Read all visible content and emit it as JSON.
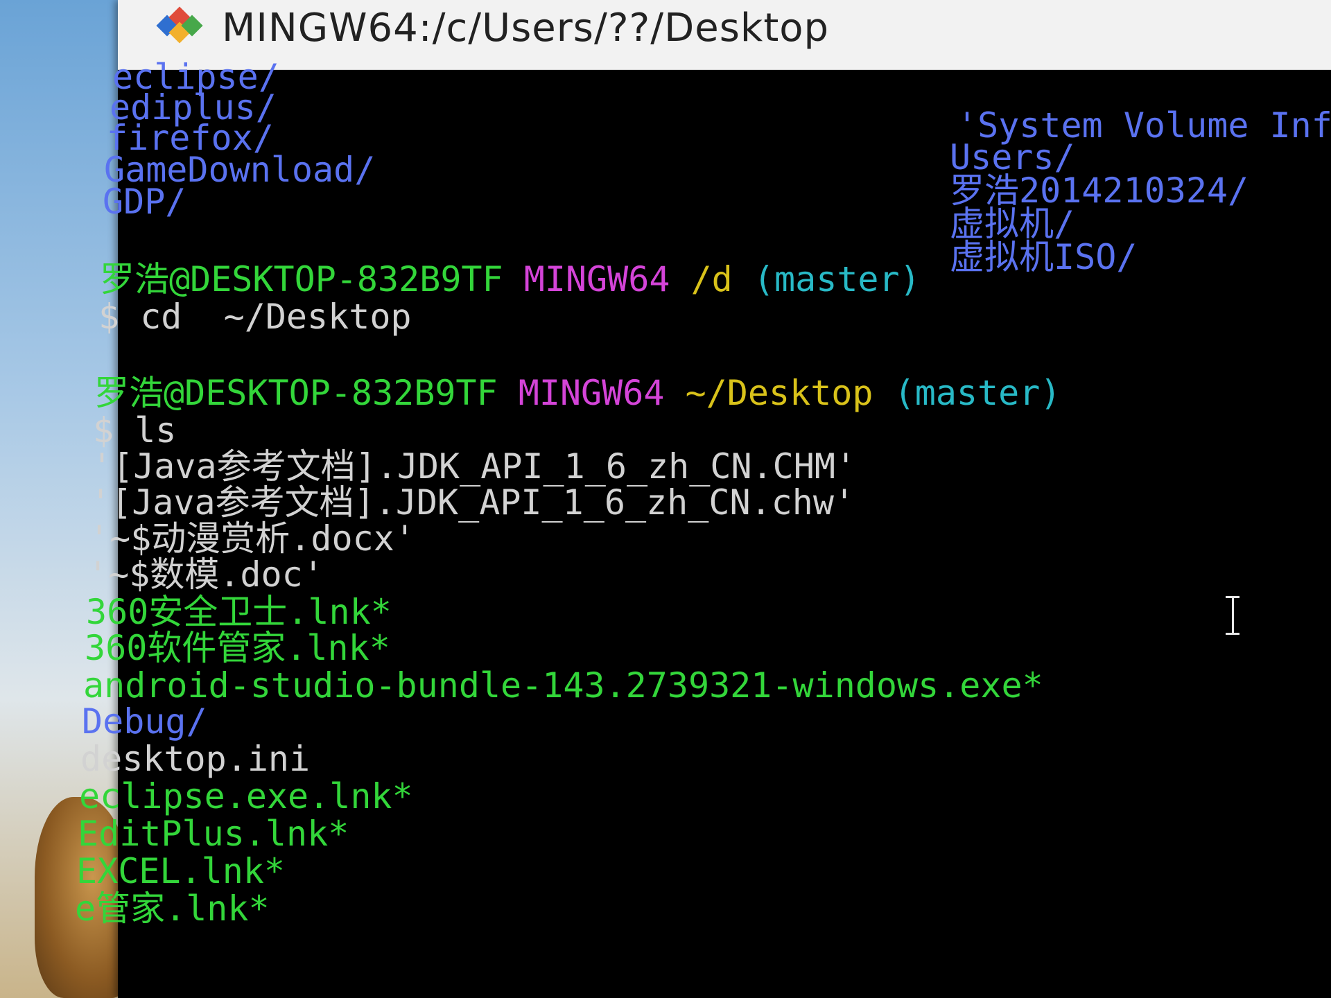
{
  "window": {
    "title": "MINGW64:/c/Users/??/Desktop"
  },
  "colors": {
    "directory": "#5a72f0",
    "executable": "#33d63a",
    "host": "#d444d8",
    "path": "#d9c21a",
    "branch": "#28b9c6",
    "plain": "#d2d2d2"
  },
  "terminal": {
    "prev_listing_left": [
      "eclipse/",
      "ediplus/",
      "firefox/",
      "GameDownload/",
      "GDP/"
    ],
    "prev_listing_right": [
      "'System Volume Inf",
      "Users/",
      "罗浩2014210324/",
      "虚拟机/",
      "虚拟机ISO/"
    ],
    "prompt1": {
      "user_host": "罗浩@DESKTOP-832B9TF",
      "shell": "MINGW64",
      "cwd": "/d",
      "branch": "(master)",
      "command": "$ cd  ~/Desktop"
    },
    "prompt2": {
      "user_host": "罗浩@DESKTOP-832B9TF",
      "shell": "MINGW64",
      "cwd": "~/Desktop",
      "branch": "(master)",
      "command": "$ ls"
    },
    "ls_output": [
      {
        "text": "'[Java参考文档].JDK_API_1_6_zh_CN.CHM'",
        "kind": "plain"
      },
      {
        "text": "'[Java参考文档].JDK_API_1_6_zh_CN.chw'",
        "kind": "plain"
      },
      {
        "text": "'~$动漫赏析.docx'",
        "kind": "plain"
      },
      {
        "text": "'~$数模.doc'",
        "kind": "plain"
      },
      {
        "text": "360安全卫士.lnk*",
        "kind": "executable"
      },
      {
        "text": "360软件管家.lnk*",
        "kind": "executable"
      },
      {
        "text": "android-studio-bundle-143.2739321-windows.exe*",
        "kind": "executable"
      },
      {
        "text": "Debug/",
        "kind": "directory"
      },
      {
        "text": "desktop.ini",
        "kind": "plain"
      },
      {
        "text": "eclipse.exe.lnk*",
        "kind": "executable"
      },
      {
        "text": "EditPlus.lnk*",
        "kind": "executable"
      },
      {
        "text": "EXCEL.lnk*",
        "kind": "executable"
      },
      {
        "text": "e管家.lnk*",
        "kind": "executable"
      }
    ]
  }
}
